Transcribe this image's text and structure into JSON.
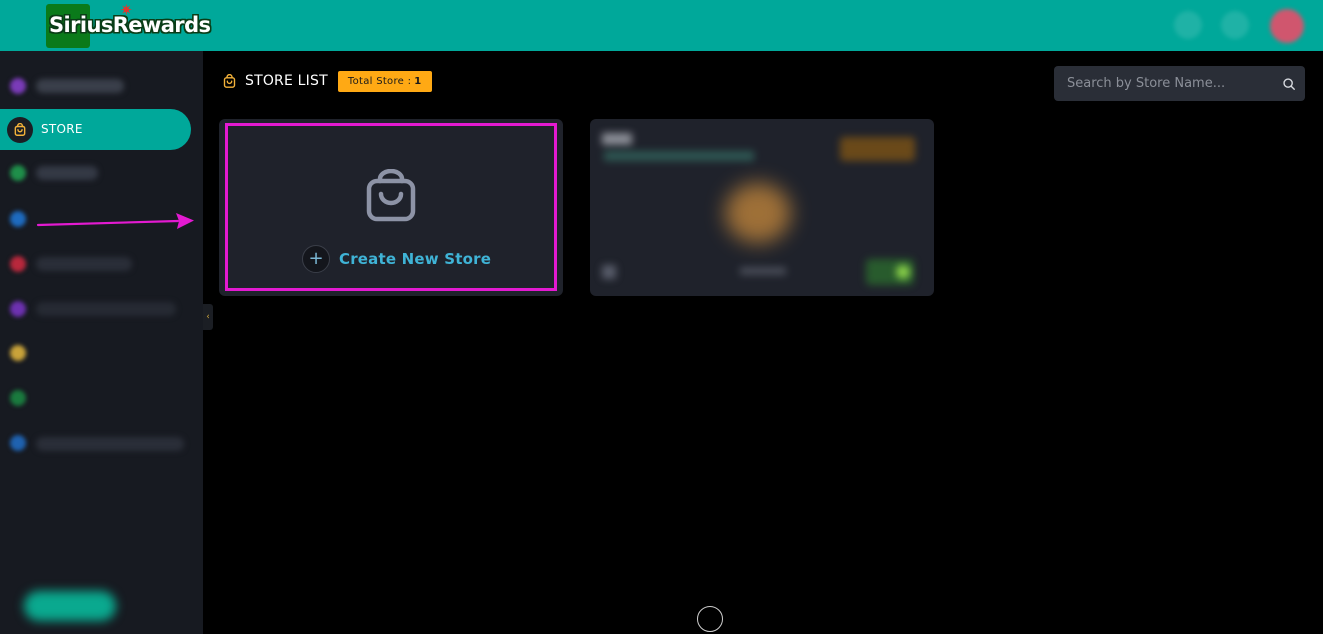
{
  "header": {
    "brand": "SiriusRewards",
    "colors": {
      "bar": "#00a89a",
      "avatar": "#d0566e"
    }
  },
  "sidebar": {
    "active_item": {
      "label": "STORE",
      "icon": "shopping-bag-icon"
    },
    "colors": {
      "background": "#171a21",
      "active": "#00a89a"
    }
  },
  "page": {
    "title": "STORE LIST",
    "title_icon": "shopping-bag-icon",
    "total_badge": {
      "label": "Total Store :",
      "count": "1",
      "color": "#ffa914"
    }
  },
  "search": {
    "placeholder": "Search by Store Name...",
    "value": "",
    "icon": "search-icon"
  },
  "create_card": {
    "label": "Create New Store",
    "icon": "shopping-bag-icon",
    "highlight_color": "#e31ad1"
  },
  "annotation": {
    "type": "arrow",
    "color": "#e31ad1"
  }
}
